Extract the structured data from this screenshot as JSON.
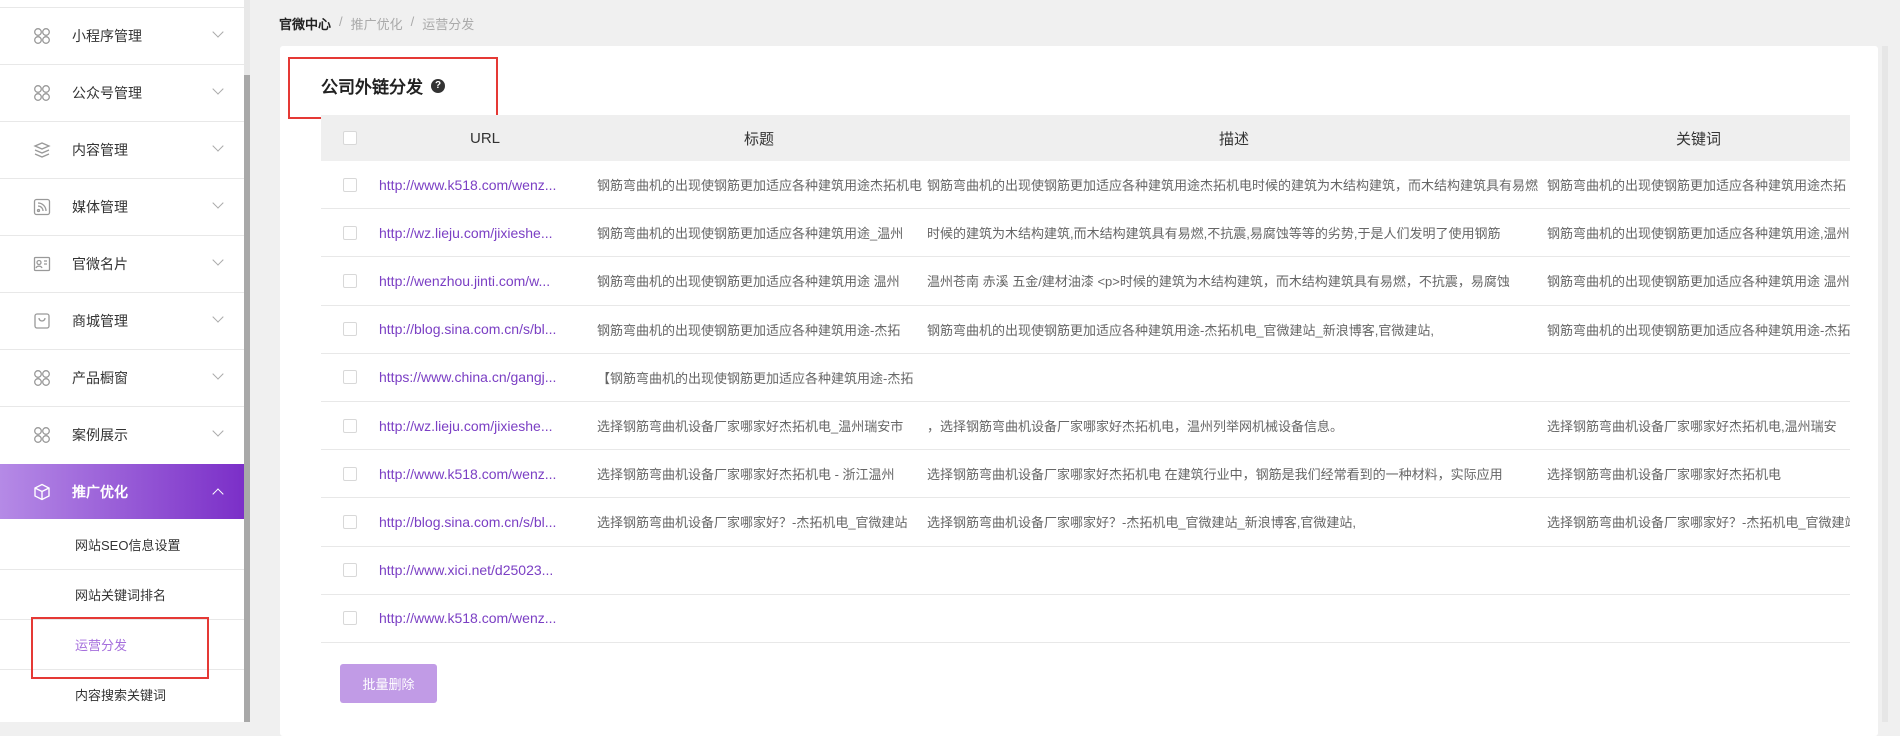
{
  "sidebar": {
    "items": [
      {
        "label": "小程序管理",
        "icon": "grid-icon"
      },
      {
        "label": "公众号管理",
        "icon": "grid-icon"
      },
      {
        "label": "内容管理",
        "icon": "layers-icon"
      },
      {
        "label": "媒体管理",
        "icon": "rss-icon"
      },
      {
        "label": "官微名片",
        "icon": "id-card-icon"
      },
      {
        "label": "商城管理",
        "icon": "bag-icon"
      },
      {
        "label": "产品橱窗",
        "icon": "grid-icon"
      },
      {
        "label": "案例展示",
        "icon": "grid-icon"
      },
      {
        "label": "推广优化",
        "icon": "box-icon"
      }
    ],
    "sub_items": [
      {
        "label": "网站SEO信息设置"
      },
      {
        "label": "网站关键词排名"
      },
      {
        "label": "运营分发"
      },
      {
        "label": "内容搜索关键词"
      }
    ]
  },
  "breadcrumb": [
    "官微中心",
    "推广优化",
    "运营分发"
  ],
  "breadcrumb_sep": "/",
  "page": {
    "title": "公司外链分发",
    "help": "?"
  },
  "table": {
    "headers": [
      "URL",
      "标题",
      "描述",
      "关键词"
    ],
    "rows": [
      {
        "url": "http://www.k518.com/wenz...",
        "title": "钢筋弯曲机的出现使钢筋更加适应各种建筑用途杰拓机电",
        "desc": "钢筋弯曲机的出现使钢筋更加适应各种建筑用途杰拓机电时候的建筑为木结构建筑，而木结构建筑具有易燃",
        "kw": "钢筋弯曲机的出现使钢筋更加适应各种建筑用途杰拓"
      },
      {
        "url": "http://wz.lieju.com/jixieshe...",
        "title": "钢筋弯曲机的出现使钢筋更加适应各种建筑用途_温州",
        "desc": "时候的建筑为木结构建筑,而木结构建筑具有易燃,不抗震,易腐蚀等等的劣势,于是人们发明了使用钢筋",
        "kw": "钢筋弯曲机的出现使钢筋更加适应各种建筑用途,温州"
      },
      {
        "url": "http://wenzhou.jinti.com/w...",
        "title": "钢筋弯曲机的出现使钢筋更加适应各种建筑用途 温州",
        "desc": "温州苍南 赤溪 五金/建材油漆 <p>时候的建筑为木结构建筑，而木结构建筑具有易燃，不抗震，易腐蚀",
        "kw": "钢筋弯曲机的出现使钢筋更加适应各种建筑用途 温州"
      },
      {
        "url": "http://blog.sina.com.cn/s/bl...",
        "title": "钢筋弯曲机的出现使钢筋更加适应各种建筑用途-杰拓",
        "desc": "钢筋弯曲机的出现使钢筋更加适应各种建筑用途-杰拓机电_官微建站_新浪博客,官微建站,",
        "kw": "钢筋弯曲机的出现使钢筋更加适应各种建筑用途-杰拓"
      },
      {
        "url": "https://www.china.cn/gangj...",
        "title": "【钢筋弯曲机的出现使钢筋更加适应各种建筑用途-杰拓",
        "desc": "",
        "kw": ""
      },
      {
        "url": "http://wz.lieju.com/jixieshe...",
        "title": "选择钢筋弯曲机设备厂家哪家好杰拓机电_温州瑞安市",
        "desc": "，选择钢筋弯曲机设备厂家哪家好杰拓机电，温州列举网机械设备信息。",
        "kw": "选择钢筋弯曲机设备厂家哪家好杰拓机电,温州瑞安"
      },
      {
        "url": "http://www.k518.com/wenz...",
        "title": "选择钢筋弯曲机设备厂家哪家好杰拓机电 - 浙江温州",
        "desc": "选择钢筋弯曲机设备厂家哪家好杰拓机电 在建筑行业中，钢筋是我们经常看到的一种材料，实际应用",
        "kw": "选择钢筋弯曲机设备厂家哪家好杰拓机电"
      },
      {
        "url": "http://blog.sina.com.cn/s/bl...",
        "title": "选择钢筋弯曲机设备厂家哪家好？-杰拓机电_官微建站",
        "desc": "选择钢筋弯曲机设备厂家哪家好？-杰拓机电_官微建站_新浪博客,官微建站,",
        "kw": "选择钢筋弯曲机设备厂家哪家好？-杰拓机电_官微建站"
      },
      {
        "url": "http://www.xici.net/d25023...",
        "title": "",
        "desc": "",
        "kw": ""
      },
      {
        "url": "http://www.k518.com/wenz...",
        "title": "",
        "desc": "",
        "kw": ""
      }
    ]
  },
  "actions": {
    "batch_delete": "批量删除"
  }
}
